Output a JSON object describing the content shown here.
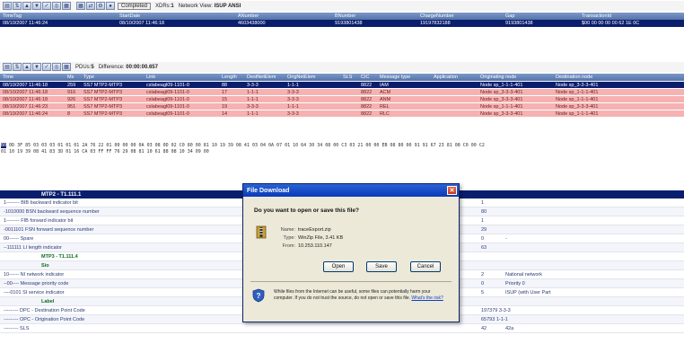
{
  "top_toolbar": {
    "status_badge": "Completed",
    "xdrs_label": "XDRs:",
    "xdrs_count": "1",
    "network_view_label": "Network View:",
    "network_view_value": "ISUP ANSI"
  },
  "xdr_grid": {
    "columns": [
      "TimeTag",
      "StartDate",
      "ANumber",
      "BNumber",
      "ChargeNumber",
      "Gap",
      "TransactionId"
    ],
    "row": [
      "08/10/2007 11:46:24",
      "08/10/2007 11:46:18",
      "4603438000",
      "9193801438",
      "19197832188",
      "9193801438",
      "$00 00 00 00 00 62 1E 0C"
    ]
  },
  "pdu_toolbar": {
    "pdus_label": "PDUs:",
    "pdus_count": "5",
    "difference_label": "Difference:",
    "difference_value": "00:00:00.657"
  },
  "pdu_grid": {
    "columns": [
      "Time",
      "Ms",
      "Type",
      "Link",
      "Length",
      "DestNetElem",
      "OrigNetElem",
      "SLS",
      "CIC",
      "Message type",
      "Application",
      "Originating node",
      "Destination node"
    ],
    "rows": [
      [
        "08/10/2007 11:46:18",
        "259",
        "SS7 MTP2-MTP3",
        "cslabeagl09-1101-0",
        "88",
        "3-3-3",
        "1-1-1",
        "",
        "8822",
        "IAM",
        "",
        "Node sp_1-1-1-401",
        "Node sp_3-3-3-401"
      ],
      [
        "08/10/2007 11:46:18",
        "916",
        "SS7 MTP2-MTP3",
        "cslabeagl09-1101-0",
        "17",
        "1-1-1",
        "3-3-3",
        "",
        "8822",
        "ACM",
        "",
        "Node sp_3-3-3-401",
        "Node sp_1-1-1-401"
      ],
      [
        "08/10/2007 11:46:18",
        "926",
        "SS7 MTP2-MTP3",
        "cslabeagl09-1101-0",
        "15",
        "1-1-1",
        "3-3-3",
        "",
        "8822",
        "ANM",
        "",
        "Node sp_3-3-3-401",
        "Node sp_1-1-1-401"
      ],
      [
        "08/10/2007 11:46:23",
        "951",
        "SS7 MTP2-MTP3",
        "cslabeagl09-1101-0",
        "19",
        "3-3-3",
        "1-1-1",
        "",
        "8822",
        "REL",
        "",
        "Node sp_1-1-1-401",
        "Node sp_3-3-3-401"
      ],
      [
        "08/10/2007 11:46:24",
        "8",
        "SS7 MTP2-MTP3",
        "cslabeagl09-1101-0",
        "14",
        "1-1-1",
        "3-3-3",
        "",
        "8822",
        "RLC",
        "",
        "Node sp_3-3-3-401",
        "Node sp_1-1-1-401"
      ]
    ]
  },
  "hex_dump": {
    "first_byte": "B0",
    "line1_rest": " 0D 3F 85 03 03 03 01 01 01 2A 76 22 01 00 00 00 0A 03 08 0D 02 C0 80 00 81 10 19 39 08 41 03 04 0A 07 01 10 64 30 34 08 00 C3 03 21 00 00 EB 08 80 00 91 91 67 23 81 08 C0 00 C2",
    "line2": "01 10 19 39 08 41 83 3D 01 16 CA 03 FF FF 76 29 08 81 10 61 88 08 10 34 09 00"
  },
  "decode": {
    "header": "MTP2 - T1.111.1",
    "rows": [
      {
        "label": "1-------- BIB backward indicator bit",
        "v1": "1",
        "v2": "",
        "head": false
      },
      {
        "label": "-1010000 BSN backward sequence number",
        "v1": "80",
        "v2": "",
        "head": false
      },
      {
        "label": "1-------- FIB forward indicator bit",
        "v1": "1",
        "v2": "",
        "head": false
      },
      {
        "label": "-0011101 FSN forward sequence number",
        "v1": "29",
        "v2": "",
        "head": false
      },
      {
        "label": "00------ Spare",
        "v1": "0",
        "v2": "-",
        "head": false
      },
      {
        "label": "--111111 LI length indicator",
        "v1": "63",
        "v2": "",
        "head": false
      },
      {
        "label": "MTP3 - T1.111.4",
        "v1": "",
        "v2": "",
        "head": true
      },
      {
        "label": "Sio",
        "v1": "",
        "v2": "",
        "head": true
      },
      {
        "label": "10------ NI network indicator",
        "v1": "2",
        "v2": "National network",
        "head": false
      },
      {
        "label": "--00---- Message priority code",
        "v1": "0",
        "v2": "Priority 0",
        "head": false
      },
      {
        "label": "----0101 SI service indicator",
        "v1": "5",
        "v2": "ISUP (with User Part",
        "head": false
      },
      {
        "label": "Label",
        "v1": "",
        "v2": "",
        "head": true
      },
      {
        "label": "--------- DPC - Destination Point Code",
        "v1": "197379 3-3-3",
        "v2": "",
        "head": false
      },
      {
        "label": "--------- OPC - Origination Point Code",
        "v1": "65793 1-1-1",
        "v2": "",
        "head": false
      },
      {
        "label": "--------- SLS",
        "v1": "42",
        "v2": "42a",
        "head": false
      }
    ]
  },
  "dialog": {
    "title": "File Download",
    "question": "Do you want to open or save this file?",
    "name_label": "Name:",
    "name_value": "traceExport.zip",
    "type_label": "Type:",
    "type_value": "WinZip File, 3.41 KB",
    "from_label": "From:",
    "from_value": "10.253.110.147",
    "open_label": "Open",
    "save_label": "Save",
    "cancel_label": "Cancel",
    "warning": "While files from the Internet can be useful, some files can potentially harm your computer. If you do not trust the source, do not open or save this file.",
    "warning_link": "What's the risk?"
  },
  "colors": {
    "selected_row": "#0a1e6e",
    "pdu_row": "#f6b2b2",
    "header": "#5573a8"
  }
}
